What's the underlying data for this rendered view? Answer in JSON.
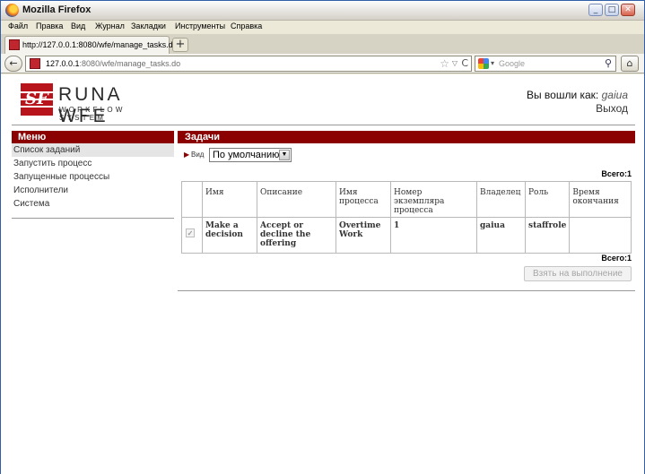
{
  "window": {
    "title": "Mozilla Firefox",
    "minimize_glyph": "_",
    "maximize_glyph": "□",
    "close_glyph": "✕"
  },
  "menu": [
    "Файл",
    "Правка",
    "Вид",
    "Журнал",
    "Закладки",
    "Инструменты",
    "Справка"
  ],
  "tab": {
    "title": "http://127.0.0.1:8080/wfe/manage_tasks.do",
    "new_tab_glyph": "+"
  },
  "nav": {
    "back_glyph": "←",
    "url_host": "127.0.0.1",
    "url_path": ":8080/wfe/manage_tasks.do",
    "star_glyph": "☆",
    "dropdown_glyph": "▽",
    "reload_glyph": "C",
    "search_placeholder": "Google",
    "search_engine_dropdown_glyph": "▾",
    "search_glyph": "⚲",
    "home_glyph": "⌂"
  },
  "logo": {
    "mark_text": "SF",
    "name": "RUNA WFE",
    "subtitle": "WORKFLOW SYSTEM"
  },
  "user": {
    "logged_in_label": "Вы вошли как:",
    "username": "gaiua",
    "logout": "Выход"
  },
  "sidebar": {
    "header": "Меню",
    "items": [
      {
        "label": "Список заданий",
        "active": true
      },
      {
        "label": "Запустить процесс",
        "active": false
      },
      {
        "label": "Запущенные процессы",
        "active": false
      },
      {
        "label": "Исполнители",
        "active": false
      },
      {
        "label": "Система",
        "active": false
      }
    ]
  },
  "main": {
    "header": "Задачи",
    "view_label": "Вид",
    "view_arrow_glyph": "▶",
    "view_value": "По умолчанию",
    "view_dropdown_glyph": "▼",
    "total_label": "Всего:1",
    "table": {
      "columns": [
        "",
        "Имя",
        "Описание",
        "Имя процесса",
        "Номер экземпляра процесса",
        "Владелец",
        "Роль",
        "Время окончания"
      ],
      "rows": [
        {
          "checkbox_glyph": "✓",
          "name": "Make a decision",
          "description": "Accept or decline the offering",
          "process_name": "Overtime Work",
          "instance": "1",
          "owner": "gaiua",
          "role": "staffrole",
          "end_time": ""
        }
      ]
    },
    "take_button": "Взять на выполнение"
  },
  "colors": {
    "accent": "#8b0000",
    "logo_red": "#b8141c"
  }
}
